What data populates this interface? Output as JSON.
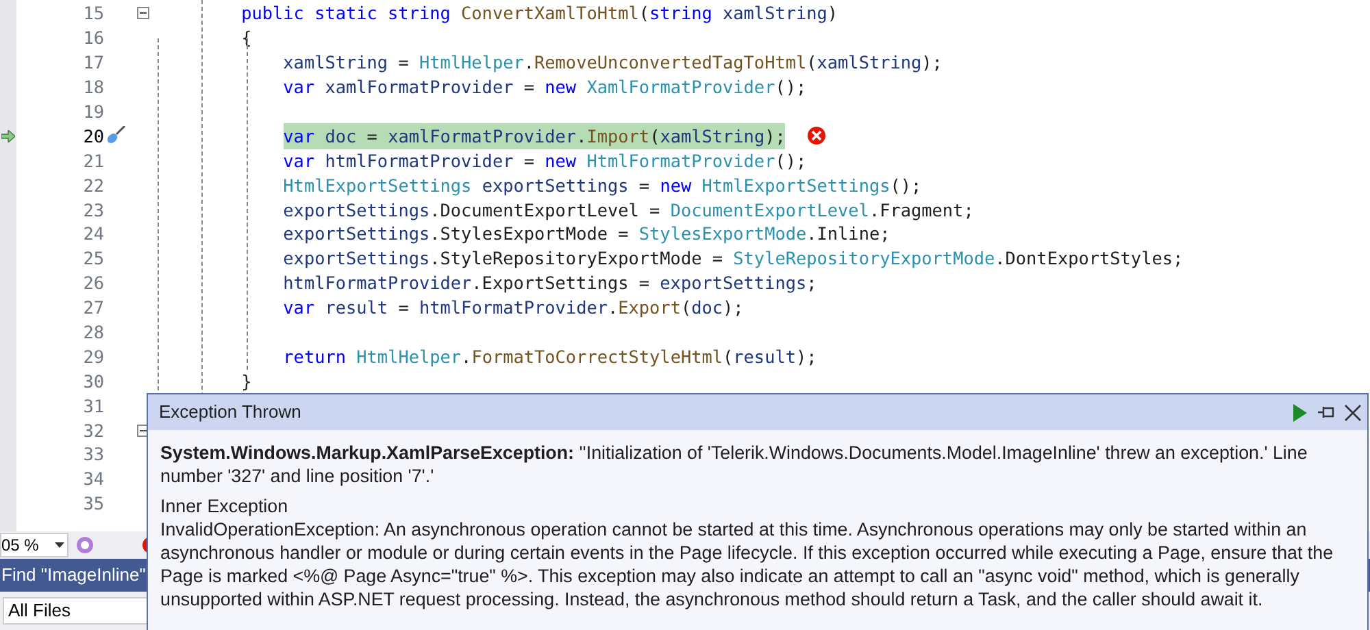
{
  "editor": {
    "lines": [
      {
        "number": "15",
        "current": false,
        "fold": true,
        "tokens": [
          {
            "kind": "keyword",
            "text": "        public static string "
          },
          {
            "kind": "method",
            "text": "ConvertXamlToHtml"
          },
          {
            "kind": "plain",
            "text": "("
          },
          {
            "kind": "keyword",
            "text": "string "
          },
          {
            "kind": "local",
            "text": "xamlString"
          },
          {
            "kind": "plain",
            "text": ")"
          }
        ]
      },
      {
        "number": "16",
        "current": false,
        "fold": false,
        "tokens": [
          {
            "kind": "plain",
            "text": "        {"
          }
        ]
      },
      {
        "number": "17",
        "current": false,
        "fold": false,
        "tokens": [
          {
            "kind": "local",
            "text": "            xamlString"
          },
          {
            "kind": "plain",
            "text": " = "
          },
          {
            "kind": "type",
            "text": "HtmlHelper"
          },
          {
            "kind": "plain",
            "text": "."
          },
          {
            "kind": "method",
            "text": "RemoveUnconvertedTagToHtml"
          },
          {
            "kind": "plain",
            "text": "("
          },
          {
            "kind": "local",
            "text": "xamlString"
          },
          {
            "kind": "plain",
            "text": ");"
          }
        ]
      },
      {
        "number": "18",
        "current": false,
        "fold": false,
        "tokens": [
          {
            "kind": "keyword",
            "text": "            var "
          },
          {
            "kind": "local",
            "text": "xamlFormatProvider"
          },
          {
            "kind": "plain",
            "text": " = "
          },
          {
            "kind": "keyword",
            "text": "new "
          },
          {
            "kind": "type",
            "text": "XamlFormatProvider"
          },
          {
            "kind": "plain",
            "text": "();"
          }
        ]
      },
      {
        "number": "19",
        "current": false,
        "fold": false
      },
      {
        "number": "20",
        "current": true,
        "fold": false,
        "tokens": [
          {
            "kind": "keyword",
            "text": "            var "
          },
          {
            "kind": "local",
            "text": "doc"
          },
          {
            "kind": "plain",
            "text": " = "
          },
          {
            "kind": "local",
            "text": "xamlFormatProvider"
          },
          {
            "kind": "plain",
            "text": "."
          },
          {
            "kind": "method",
            "text": "Import"
          },
          {
            "kind": "plain",
            "text": "("
          },
          {
            "kind": "local",
            "text": "xamlString"
          },
          {
            "kind": "plain",
            "text": ");"
          }
        ]
      },
      {
        "number": "21",
        "current": false,
        "fold": false,
        "tokens": [
          {
            "kind": "keyword",
            "text": "            var "
          },
          {
            "kind": "local",
            "text": "htmlFormatProvider"
          },
          {
            "kind": "plain",
            "text": " = "
          },
          {
            "kind": "keyword",
            "text": "new "
          },
          {
            "kind": "type",
            "text": "HtmlFormatProvider"
          },
          {
            "kind": "plain",
            "text": "();"
          }
        ]
      },
      {
        "number": "22",
        "current": false,
        "fold": false,
        "tokens": [
          {
            "kind": "type",
            "text": "            HtmlExportSettings "
          },
          {
            "kind": "local",
            "text": "exportSettings"
          },
          {
            "kind": "plain",
            "text": " = "
          },
          {
            "kind": "keyword",
            "text": "new "
          },
          {
            "kind": "type",
            "text": "HtmlExportSettings"
          },
          {
            "kind": "plain",
            "text": "();"
          }
        ]
      },
      {
        "number": "23",
        "current": false,
        "fold": false,
        "tokens": [
          {
            "kind": "local",
            "text": "            exportSettings"
          },
          {
            "kind": "plain",
            "text": ".DocumentExportLevel = "
          },
          {
            "kind": "type",
            "text": "DocumentExportLevel"
          },
          {
            "kind": "plain",
            "text": ".Fragment;"
          }
        ]
      },
      {
        "number": "24",
        "current": false,
        "fold": false,
        "tokens": [
          {
            "kind": "local",
            "text": "            exportSettings"
          },
          {
            "kind": "plain",
            "text": ".StylesExportMode = "
          },
          {
            "kind": "type",
            "text": "StylesExportMode"
          },
          {
            "kind": "plain",
            "text": ".Inline;"
          }
        ]
      },
      {
        "number": "25",
        "current": false,
        "fold": false,
        "tokens": [
          {
            "kind": "local",
            "text": "            exportSettings"
          },
          {
            "kind": "plain",
            "text": ".StyleRepositoryExportMode = "
          },
          {
            "kind": "type",
            "text": "StyleRepositoryExportMode"
          },
          {
            "kind": "plain",
            "text": ".DontExportStyles;"
          }
        ]
      },
      {
        "number": "26",
        "current": false,
        "fold": false,
        "tokens": [
          {
            "kind": "local",
            "text": "            htmlFormatProvider"
          },
          {
            "kind": "plain",
            "text": ".ExportSettings = "
          },
          {
            "kind": "local",
            "text": "exportSettings"
          },
          {
            "kind": "plain",
            "text": ";"
          }
        ]
      },
      {
        "number": "27",
        "current": false,
        "fold": false,
        "tokens": [
          {
            "kind": "keyword",
            "text": "            var "
          },
          {
            "kind": "local",
            "text": "result"
          },
          {
            "kind": "plain",
            "text": " = "
          },
          {
            "kind": "local",
            "text": "htmlFormatProvider"
          },
          {
            "kind": "plain",
            "text": "."
          },
          {
            "kind": "method",
            "text": "Export"
          },
          {
            "kind": "plain",
            "text": "("
          },
          {
            "kind": "local",
            "text": "doc"
          },
          {
            "kind": "plain",
            "text": ");"
          }
        ]
      },
      {
        "number": "28",
        "current": false,
        "fold": false
      },
      {
        "number": "29",
        "current": false,
        "fold": false,
        "tokens": [
          {
            "kind": "keyword",
            "text": "            return "
          },
          {
            "kind": "type",
            "text": "HtmlHelper"
          },
          {
            "kind": "plain",
            "text": "."
          },
          {
            "kind": "method",
            "text": "FormatToCorrectStyleHtml"
          },
          {
            "kind": "plain",
            "text": "("
          },
          {
            "kind": "local",
            "text": "result"
          },
          {
            "kind": "plain",
            "text": ");"
          }
        ]
      },
      {
        "number": "30",
        "current": false,
        "fold": false,
        "tokens": [
          {
            "kind": "plain",
            "text": "        }"
          }
        ]
      },
      {
        "number": "31",
        "current": false,
        "fold": false
      },
      {
        "number": "32",
        "current": false,
        "fold": true
      },
      {
        "number": "33",
        "current": false,
        "fold": false
      },
      {
        "number": "34",
        "current": false,
        "fold": false
      },
      {
        "number": "35",
        "current": false,
        "fold": false
      }
    ]
  },
  "status_bar": {
    "zoom": "05 %"
  },
  "find_panel": {
    "title": "Find \"ImageInline\"",
    "scope": "All Files"
  },
  "exception_popup": {
    "title": "Exception Thrown",
    "exception_type": "System.Windows.Markup.XamlParseException:",
    "message": "''Initialization of 'Telerik.Windows.Documents.Model.ImageInline' threw an exception.' Line number '327' and line position '7'.'",
    "inner_title": "Inner Exception",
    "inner_message": "InvalidOperationException: An asynchronous operation cannot be started at this time. Asynchronous operations may only be started within an asynchronous handler or module or during certain events in the Page lifecycle. If this exception occurred while executing a Page, ensure that the Page is marked <%@ Page Async=\"true\" %>. This exception may also indicate an attempt to call an \"async void\" method, which is generally unsupported within ASP.NET request processing. Instead, the asynchronous method should return a Task, and the caller should await it."
  }
}
